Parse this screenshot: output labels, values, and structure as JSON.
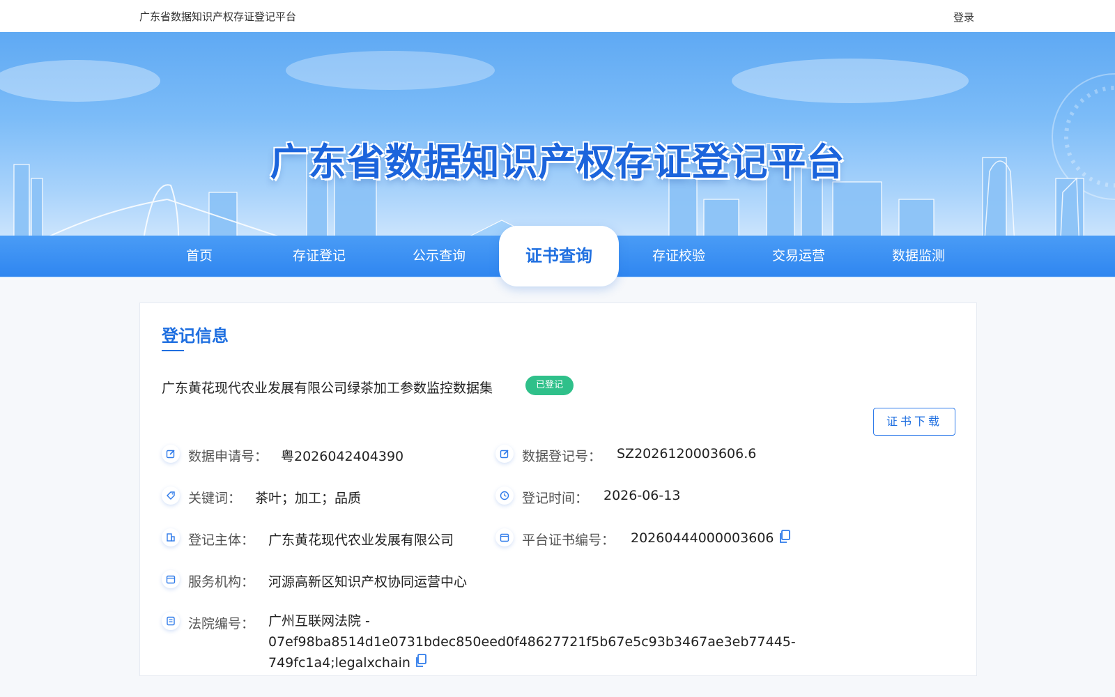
{
  "topbar": {
    "site_name": "广东省数据知识产权存证登记平台",
    "login": "登录"
  },
  "banner": {
    "title": "广东省数据知识产权存证登记平台"
  },
  "nav": {
    "items": [
      "首页",
      "存证登记",
      "公示查询",
      "证书查询",
      "存证校验",
      "交易运营",
      "数据监测"
    ],
    "active": "证书查询"
  },
  "section": {
    "title": "登记信息"
  },
  "asset": {
    "name": "广东黄花现代农业发展有限公司绿茶加工参数监控数据集",
    "status": "已登记"
  },
  "download_button": "证书下载",
  "fields": {
    "application_no": {
      "label": "数据申请号：",
      "value": "粤2026042404390"
    },
    "registration_no": {
      "label": "数据登记号：",
      "value": "SZ2026120003606.6"
    },
    "keywords": {
      "label": "关键词：",
      "value": "茶叶；加工；品质"
    },
    "registration_time": {
      "label": "登记时间：",
      "value": "2026-06-13"
    },
    "subject": {
      "label": "登记主体：",
      "value": "广东黄花现代农业发展有限公司"
    },
    "certificate_no": {
      "label": "平台证书编号：",
      "value": "20260444000003606"
    },
    "service_org": {
      "label": "服务机构：",
      "value": "河源高新区知识产权协同运营中心"
    },
    "court_no": {
      "label": "法院编号：",
      "value": "广州互联网法院 - 07ef98ba8514d1e0731bdec850eed0f48627721f5b67e5c93b3467ae3eb77445-749fc1a4;legalxchain"
    }
  },
  "colors": {
    "primary": "#1f6fe0",
    "nav": "#2f86f0",
    "badge": "#2fc08a"
  }
}
